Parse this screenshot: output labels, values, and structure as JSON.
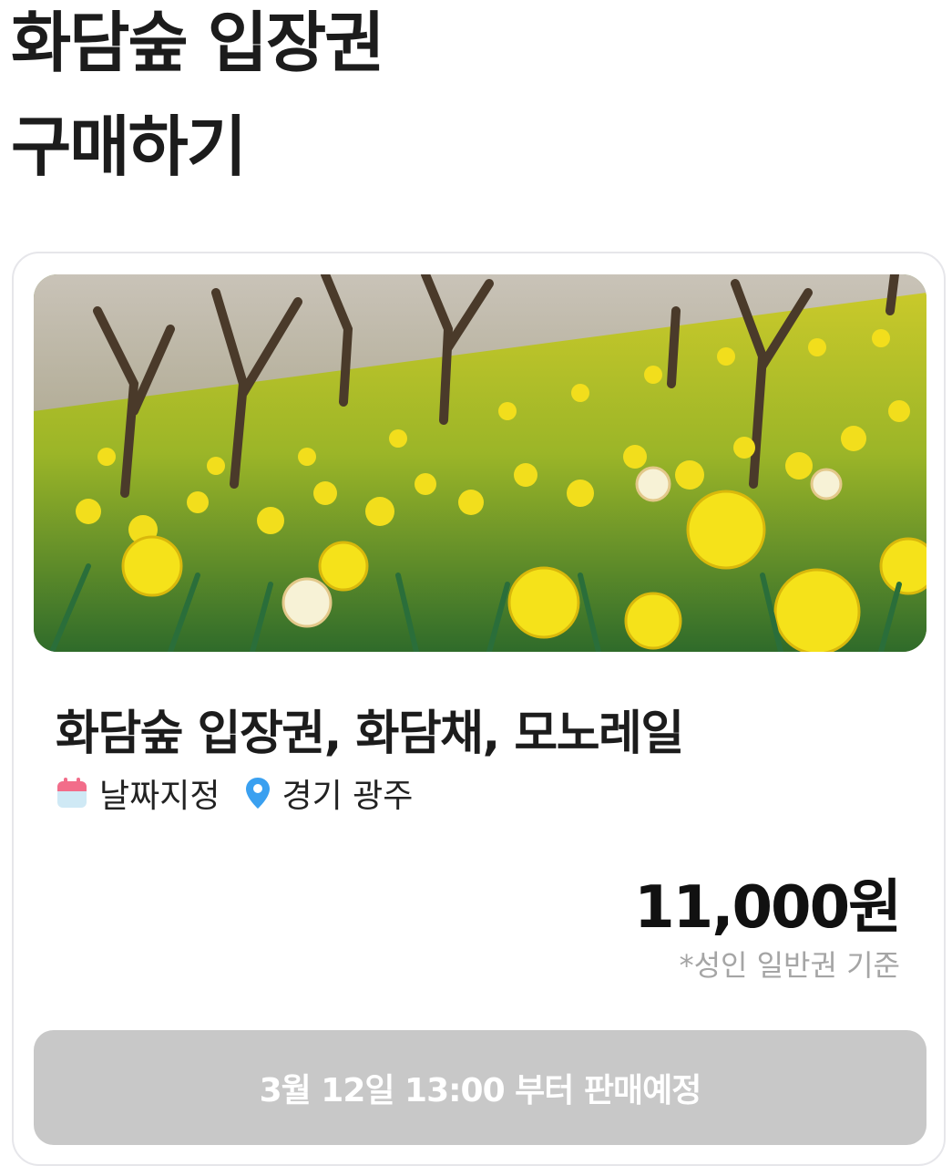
{
  "header": {
    "title": "화담숲 입장권\n구매하기"
  },
  "product": {
    "image_alt": "daffodil-field-photo",
    "name": "화담숲 입장권, 화담채, 모노레일",
    "date_label": "날짜지정",
    "location_label": "경기 광주",
    "price": "11,000원",
    "price_note": "*성인 일반권 기준",
    "sale_button_label": "3월 12일 13:00 부터 판매예정"
  },
  "icons": {
    "date": "calendar-icon",
    "location": "map-pin-icon"
  },
  "colors": {
    "calendar_top": "#f26d8a",
    "calendar_body": "#cfe9f5",
    "pin": "#3aa0f0",
    "button_disabled": "#c8c8c8",
    "price_note": "#a5a5a5"
  }
}
